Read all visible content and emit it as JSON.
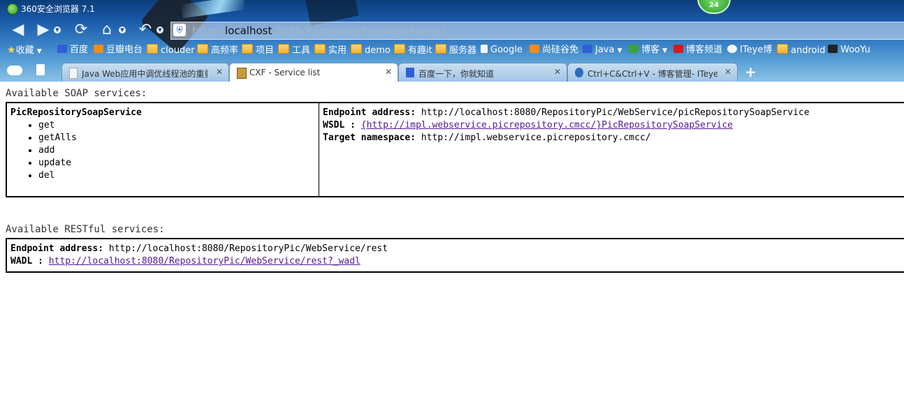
{
  "window": {
    "title": "360安全浏览器 7.1",
    "badge": "24"
  },
  "address": {
    "prefix": "http://",
    "host": "localhost",
    "path": ":8080/RepositoryPic/WebService/"
  },
  "bookmarks": [
    {
      "label": "收藏",
      "icon": "star-icon"
    },
    {
      "label": "百度",
      "icon": "baidu-paw-icon"
    },
    {
      "label": "豆瓣电台",
      "icon": "douban-icon"
    },
    {
      "label": "clouder",
      "icon": "folder-icon"
    },
    {
      "label": "高频率",
      "icon": "folder-icon"
    },
    {
      "label": "项目",
      "icon": "folder-icon"
    },
    {
      "label": "工具",
      "icon": "folder-icon"
    },
    {
      "label": "实用",
      "icon": "folder-icon"
    },
    {
      "label": "demo",
      "icon": "folder-icon"
    },
    {
      "label": "有趣it",
      "icon": "folder-icon"
    },
    {
      "label": "服务器",
      "icon": "folder-icon"
    },
    {
      "label": "Google",
      "icon": "page-icon"
    },
    {
      "label": "尚硅谷免",
      "icon": "atguigu-icon"
    },
    {
      "label": "Java",
      "icon": "b-icon"
    },
    {
      "label": "博客",
      "icon": "c-green-icon"
    },
    {
      "label": "博客频道",
      "icon": "csdn-icon"
    },
    {
      "label": "ITeye博",
      "icon": "iteye-icon"
    },
    {
      "label": "android",
      "icon": "folder-icon"
    },
    {
      "label": "WooYu",
      "icon": "wooyun-icon"
    }
  ],
  "tabs": [
    {
      "label": "Java Web应用中调优线程池的重要",
      "active": false
    },
    {
      "label": "CXF - Service list",
      "active": true
    },
    {
      "label": "百度一下，你就知道",
      "active": false
    },
    {
      "label": "Ctrl+C&Ctrl+V - 博客管理- ITeye",
      "active": false
    }
  ],
  "page": {
    "soap_heading": "Available SOAP services:",
    "soap": {
      "service_name": "PicRepositorySoapService",
      "operations": [
        "get",
        "getAlls",
        "add",
        "update",
        "del"
      ],
      "endpoint_label": "Endpoint address:",
      "endpoint": "http://localhost:8080/RepositoryPic/WebService/picRepositorySoapService",
      "wsdl_label": "WSDL :",
      "wsdl": "{http://impl.webservice.picrepository.cmcc/}PicRepositorySoapService",
      "ns_label": "Target namespace:",
      "ns": "http://impl.webservice.picrepository.cmcc/"
    },
    "rest_heading": "Available RESTful services:",
    "rest": {
      "endpoint_label": "Endpoint address:",
      "endpoint": "http://localhost:8080/RepositoryPic/WebService/rest",
      "wadl_label": "WADL :",
      "wadl": "http://localhost:8080/RepositoryPic/WebService/rest?_wadl"
    }
  }
}
